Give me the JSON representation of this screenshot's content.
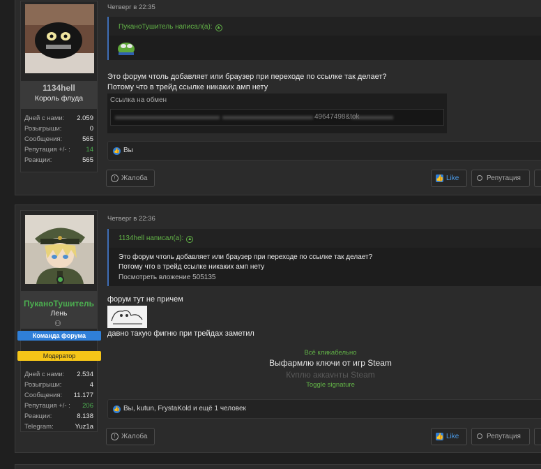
{
  "posts": [
    {
      "user": {
        "name": "1134hell",
        "title": "Король флуда",
        "stats": [
          {
            "key": "Дней с нами:",
            "value": "2.059"
          },
          {
            "key": "Розыгрыши:",
            "value": "0"
          },
          {
            "key": "Сообщения:",
            "value": "565"
          },
          {
            "key": "Репутация +/- :",
            "value": "14"
          },
          {
            "key": "Реакции:",
            "value": "565"
          }
        ]
      },
      "date": "Четверг в 22:35",
      "quote": {
        "author": "ПуканоТушитель написал(а):"
      },
      "body_lines": [
        "Это форум чтоль добавляет или браузер при переходе по ссылке так делает?",
        "Потому что в трейд ссылке никаких амп нету"
      ],
      "spoiler": {
        "title": "Ссылка на обмен",
        "visible_url": "49647498&tok"
      },
      "reactions": "Вы",
      "buttons": {
        "report": "Жалоба",
        "like": "Like",
        "reputation": "Репутация"
      }
    },
    {
      "user": {
        "name": "ПуканоТушитель",
        "title": "Лень",
        "badges": [
          "Команда форума",
          "Модератор"
        ],
        "stats": [
          {
            "key": "Дней с нами:",
            "value": "2.534"
          },
          {
            "key": "Розыгрыши:",
            "value": "4"
          },
          {
            "key": "Сообщения:",
            "value": "11.177"
          },
          {
            "key": "Репутация +/- :",
            "value": "206"
          },
          {
            "key": "Реакции:",
            "value": "8.138"
          },
          {
            "key": "Telegram:",
            "value": "Yuz1a"
          }
        ]
      },
      "date": "Четверг в 22:36",
      "quote": {
        "author": "1134hell написал(а):",
        "lines": [
          "Это форум чтоль добавляет или браузер при переходе по ссылке так делает?",
          "Потому что в трейд ссылке никаких амп нету"
        ],
        "attachment": "Посмотреть вложение 505135"
      },
      "body_line_1": "форум тут не причем",
      "body_line_2": "давно такую фигню при трейдах заметил",
      "signature": {
        "line1": "Всё кликабельно",
        "line2": "Выфармлю ключи от игр Steam",
        "line3": "Куплю аккаунты Steam",
        "toggle": "Toggle signature"
      },
      "reactions": "Вы, kutun, FrystaKold и ещё 1 человек",
      "buttons": {
        "report": "Жалоба",
        "like": "Like",
        "reputation": "Репутация"
      }
    }
  ],
  "colors": {
    "background": "#1f1f1f",
    "post": "#2b2b2b",
    "quote_author": "#62b347",
    "like_blue": "#2f7fd8",
    "mod_name": "#4caf50",
    "badge_team": "#2f7fd8",
    "badge_mod": "#f5c518"
  }
}
